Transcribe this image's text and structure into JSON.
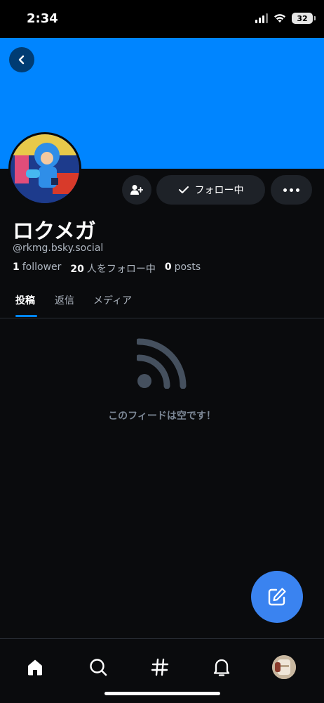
{
  "status_bar": {
    "time": "2:34",
    "battery": "32"
  },
  "profile": {
    "display_name": "ロクメガ",
    "handle": "@rkmg.bsky.social",
    "followers_count": "1",
    "followers_label": "follower",
    "following_count": "20",
    "following_label": "人をフォロー中",
    "posts_count": "0",
    "posts_label": "posts"
  },
  "actions": {
    "follow_label": "フォロー中"
  },
  "tabs": [
    {
      "label": "投稿",
      "active": true
    },
    {
      "label": "返信",
      "active": false
    },
    {
      "label": "メディア",
      "active": false
    }
  ],
  "feed": {
    "empty_message": "このフィードは空です！"
  },
  "colors": {
    "accent": "#0085ff",
    "banner": "#0085ff",
    "fab": "#3a83f0",
    "background": "#0a0b0d",
    "button_bg": "#1e2228"
  },
  "icons": [
    "chevron-left-icon",
    "add-user-icon",
    "check-icon",
    "more-icon",
    "feed-icon",
    "compose-icon",
    "home-icon",
    "search-icon",
    "hashtag-icon",
    "bell-icon"
  ]
}
